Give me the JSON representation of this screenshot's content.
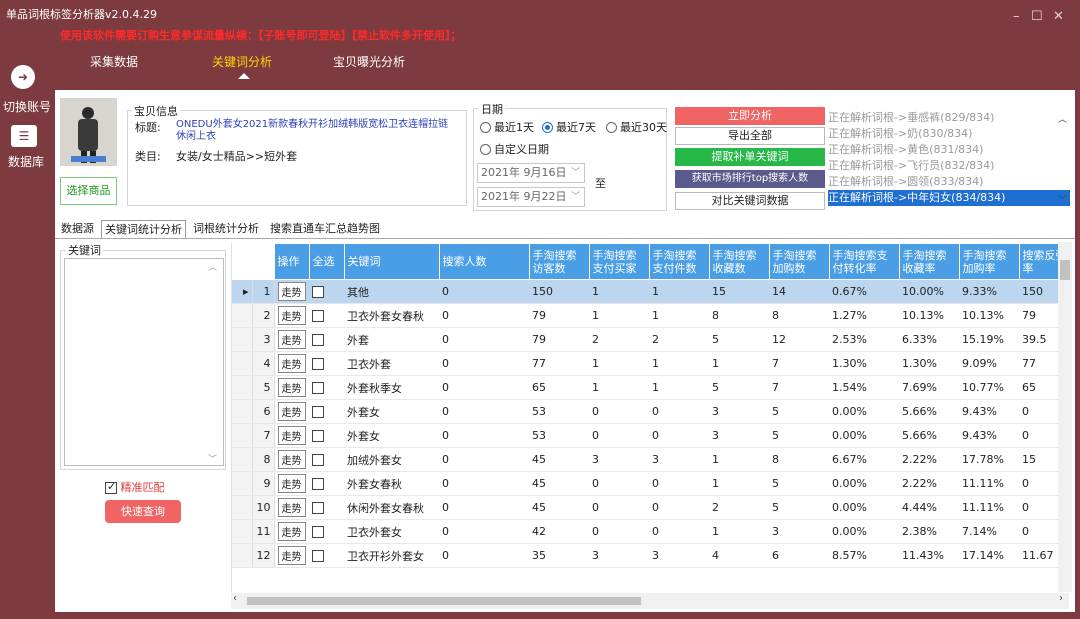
{
  "app": {
    "title": "单品词根标签分析器v2.0.4.29",
    "notice_a": "使用该软件需要订购生意参谋流量纵横：",
    "notice_b": "【子账号即可登陆】【禁止软件多开使用】；"
  },
  "window": {
    "minimize": "–",
    "maximize": "☐",
    "close": "✕"
  },
  "topnav": {
    "items": [
      "采集数据",
      "关键词分析",
      "宝贝曝光分析"
    ],
    "active": 1
  },
  "sidebar": {
    "switch_label": "切换账号",
    "db_label": "数据库"
  },
  "product": {
    "group_label": "宝贝信息",
    "title_label": "标题:",
    "title_line1": "ONEDU外套女2021新款春秋开衫加绒韩版宽松卫衣连帽拉链",
    "title_line2": "休闲上衣",
    "category_label": "类目:",
    "category_value": "女装/女士精品>>短外套",
    "select_button": "选择商品"
  },
  "date": {
    "group_label": "日期",
    "opt1": "最近1天",
    "opt2": "最近7天",
    "opt3": "最近30天",
    "opt4": "自定义日期",
    "start": "2021年 9月16日",
    "end": "2021年 9月22日",
    "to": "至"
  },
  "actions": {
    "analyze": "立即分析",
    "export": "导出全部",
    "extract": "提取补单关键词",
    "fetch": "获取市场排行top搜索人数",
    "compare": "对比关键词数据"
  },
  "status_lines": [
    "正在解析词根->垂感裤(829/834)",
    "正在解析词根->奶(830/834)",
    "正在解析词根->黄色(831/834)",
    "正在解析词根->飞行员(832/834)",
    "正在解析词根->圆领(833/834)",
    "正在解析词根->中年妇女(834/834)"
  ],
  "tabs": [
    "数据源",
    "关键词统计分析",
    "词根统计分析",
    "搜索直通车汇总趋势图"
  ],
  "left": {
    "keyword_label": "关键词",
    "exact": "精准匹配",
    "query": "快速查询"
  },
  "table": {
    "headers": [
      "操作",
      "全选",
      "关键词",
      "搜索人数",
      "手淘搜索访客数",
      "手淘搜索支付买家",
      "手淘搜索支付件数",
      "手淘搜索收藏数",
      "手淘搜索加购数",
      "手淘搜索支付转化率",
      "手淘搜索收藏率",
      "手淘搜索加购率",
      "搜索反弹率"
    ],
    "trend": "走势",
    "rows": [
      [
        "1",
        "其他",
        "0",
        "150",
        "1",
        "1",
        "15",
        "14",
        "0.67%",
        "10.00%",
        "9.33%",
        "150"
      ],
      [
        "2",
        "卫衣外套女春秋",
        "0",
        "79",
        "1",
        "1",
        "8",
        "8",
        "1.27%",
        "10.13%",
        "10.13%",
        "79"
      ],
      [
        "3",
        "外套",
        "0",
        "79",
        "2",
        "2",
        "5",
        "12",
        "2.53%",
        "6.33%",
        "15.19%",
        "39.5"
      ],
      [
        "4",
        "卫衣外套",
        "0",
        "77",
        "1",
        "1",
        "1",
        "7",
        "1.30%",
        "1.30%",
        "9.09%",
        "77"
      ],
      [
        "5",
        "外套秋季女",
        "0",
        "65",
        "1",
        "1",
        "5",
        "7",
        "1.54%",
        "7.69%",
        "10.77%",
        "65"
      ],
      [
        "6",
        "外套女",
        "0",
        "53",
        "0",
        "0",
        "3",
        "5",
        "0.00%",
        "5.66%",
        "9.43%",
        "0"
      ],
      [
        "7",
        "外套女",
        "0",
        "53",
        "0",
        "0",
        "3",
        "5",
        "0.00%",
        "5.66%",
        "9.43%",
        "0"
      ],
      [
        "8",
        "加绒外套女",
        "0",
        "45",
        "3",
        "3",
        "1",
        "8",
        "6.67%",
        "2.22%",
        "17.78%",
        "15"
      ],
      [
        "9",
        "外套女春秋",
        "0",
        "45",
        "0",
        "0",
        "1",
        "5",
        "0.00%",
        "2.22%",
        "11.11%",
        "0"
      ],
      [
        "10",
        "休闲外套女春秋",
        "0",
        "45",
        "0",
        "0",
        "2",
        "5",
        "0.00%",
        "4.44%",
        "11.11%",
        "0"
      ],
      [
        "11",
        "卫衣外套女",
        "0",
        "42",
        "0",
        "0",
        "1",
        "3",
        "0.00%",
        "2.38%",
        "7.14%",
        "0"
      ],
      [
        "12",
        "卫衣开衫外套女",
        "0",
        "35",
        "3",
        "3",
        "4",
        "6",
        "8.57%",
        "11.43%",
        "17.14%",
        "11.67"
      ]
    ]
  },
  "colors": {
    "bg": "#7d3a3f",
    "header": "#4a9ee6",
    "red": "#f05a5a",
    "green": "#28b84a",
    "purple": "#5a5a8c",
    "selected": "#bcd6ef"
  }
}
